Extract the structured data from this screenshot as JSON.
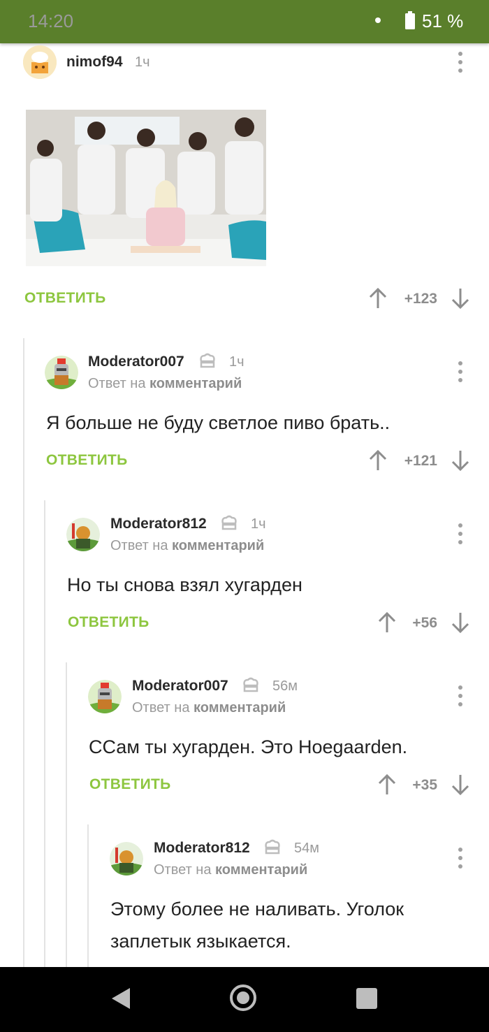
{
  "status_bar": {
    "time": "14:20",
    "battery": "51 %"
  },
  "labels": {
    "reply_to_prefix": "Ответ на",
    "reply_to_target": "комментарий",
    "reply_button": "ОТВЕТИТЬ"
  },
  "post": {
    "author": "nimof94",
    "time": "1ч",
    "score": "+123"
  },
  "comments": [
    {
      "author": "Moderator007",
      "time": "1ч",
      "text": "Я больше не буду светлое пиво брать..",
      "score": "+121"
    },
    {
      "author": "Moderator812",
      "time": "1ч",
      "text": "Но ты снова взял хугарден",
      "score": "+56"
    },
    {
      "author": "Moderator007",
      "time": "56м",
      "text": "ССам ты хугарден. Это Hoegaarden.",
      "score": "+35"
    },
    {
      "author": "Moderator812",
      "time": "54м",
      "text": "Этому более не наливать. Уголок заплетык языкается.",
      "score": ""
    }
  ],
  "colors": {
    "status_bar": "#5a7f2b",
    "reply_accent": "#8dc63f"
  }
}
